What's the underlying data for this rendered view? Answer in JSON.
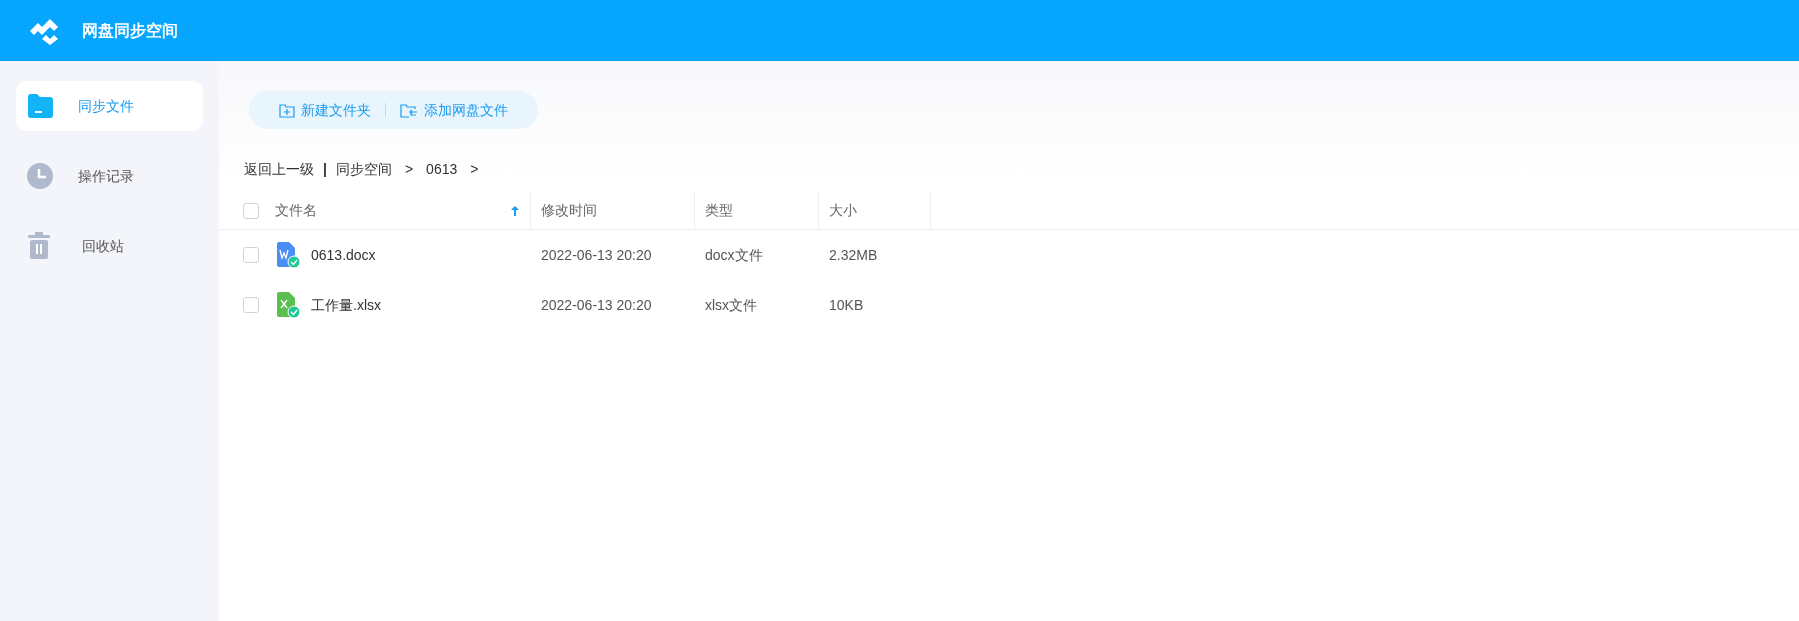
{
  "header": {
    "title": "网盘同步空间"
  },
  "sidebar": {
    "items": [
      {
        "label": "同步文件",
        "kind": "folder",
        "selected": true
      },
      {
        "label": "操作记录",
        "kind": "clock",
        "selected": false
      },
      {
        "label": "回收站",
        "kind": "trash",
        "selected": false
      }
    ]
  },
  "toolbar": {
    "buttons": [
      {
        "label": "新建文件夹",
        "kind": "new-folder"
      },
      {
        "label": "添加网盘文件",
        "kind": "add-file"
      }
    ]
  },
  "breadcrumb": {
    "back": "返回上一级",
    "separator": "|",
    "path": [
      "同步空间",
      "0613"
    ],
    "arrow": ">"
  },
  "table": {
    "select_all": {
      "checked": false
    },
    "columns": [
      {
        "label": "文件名",
        "sorted_ascending": true
      },
      {
        "label": "修改时间"
      },
      {
        "label": "类型"
      },
      {
        "label": "大小"
      }
    ],
    "rows": [
      {
        "kind": "word",
        "checked": false,
        "synced": true,
        "name": "0613.docx",
        "modified": "2022-06-13 20:20",
        "type": "docx文件",
        "size": "2.32MB"
      },
      {
        "kind": "excel",
        "checked": false,
        "synced": true,
        "name": "工作量.xlsx",
        "modified": "2022-06-13 20:20",
        "type": "xlsx文件",
        "size": "10KB"
      }
    ]
  }
}
